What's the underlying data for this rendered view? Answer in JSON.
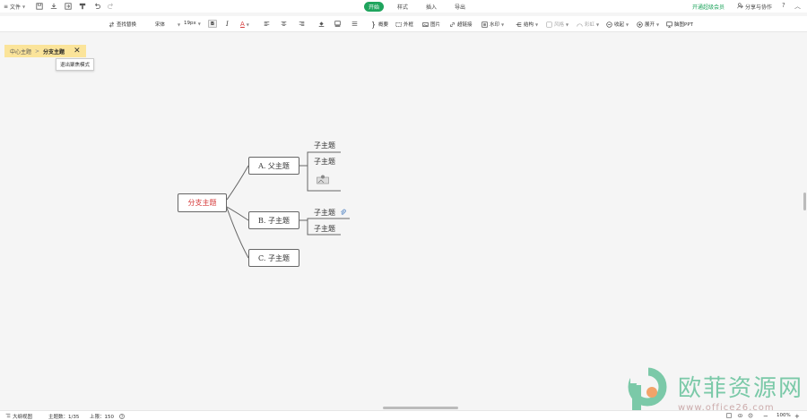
{
  "topbar": {
    "file_label": "文件",
    "tabs": [
      {
        "label": "开始",
        "active": true
      },
      {
        "label": "样式",
        "active": false
      },
      {
        "label": "插入",
        "active": false
      },
      {
        "label": "导出",
        "active": false
      }
    ],
    "vip_label": "开通超级会员",
    "share_label": "分享与协作",
    "help_label": "?"
  },
  "toolbar": {
    "find_replace": "查找替换",
    "font_family": "宋体",
    "font_size": "19px",
    "bold": "B",
    "italic": "I",
    "font_color": "A",
    "summary": "概要",
    "outer_frame": "外框",
    "image": "图片",
    "hyperlink": "超链接",
    "watermark": "水印",
    "layout": "结构",
    "style": "风格",
    "rainbow": "彩虹",
    "collapse": "收起",
    "expand": "展开",
    "ppt": "脑图PPT"
  },
  "breadcrumb": {
    "root": "中心主题",
    "separator": ">",
    "current": "分支主题",
    "close": "✕"
  },
  "tooltip": "退出聚焦模式",
  "mindmap": {
    "root": "分支主题",
    "branches": [
      {
        "label": "A. 父主题",
        "children": [
          "子主题",
          "子主题"
        ]
      },
      {
        "label": "B. 子主题",
        "children": [
          "子主题",
          "子主题"
        ]
      },
      {
        "label": "C. 子主题",
        "children": []
      }
    ]
  },
  "statusbar": {
    "outline_view": "大纲视图",
    "topic_count": "主题数：1/35",
    "limit": "上限：150",
    "zoom": "100%",
    "zoom_out": "−",
    "zoom_in": "+"
  },
  "watermark": {
    "cn": "欧菲资源网",
    "url": "www.office26.com"
  },
  "colors": {
    "accent_green": "#1fa45d",
    "breadcrumb_bg": "#fbe49a",
    "root_text": "#d63a3a"
  }
}
